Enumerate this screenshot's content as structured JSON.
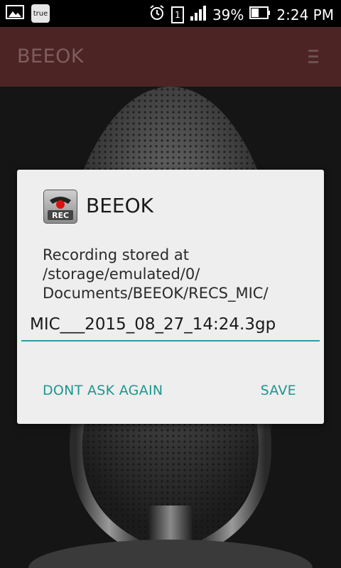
{
  "status_bar": {
    "carrier_badge": "true",
    "sim_slot": "1",
    "battery": "39%",
    "time": "2:24 PM"
  },
  "app_bar": {
    "title": "BEEOK",
    "menu_icon": "hamburger-menu-icon"
  },
  "dialog": {
    "title": "BEEOK",
    "icon": "rec-phone-icon",
    "icon_label": "REC",
    "message": "Recording stored at /storage/emulated/0/ Documents/BEEOK/RECS_MIC/",
    "filename": "MIC___2015_08_27_14:24.3gp",
    "negative_label": "DONT ASK AGAIN",
    "positive_label": "SAVE",
    "accent_color": "#1f968f"
  }
}
